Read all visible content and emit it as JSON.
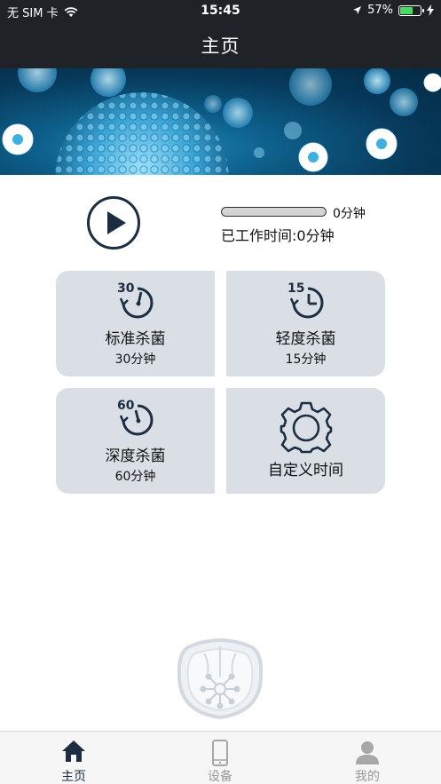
{
  "status_bar": {
    "carrier": "无 SIM 卡",
    "time": "15:45",
    "battery": "57%",
    "battery_level": 0.57,
    "icons": [
      "wifi-icon",
      "location-arrow-icon",
      "battery-icon",
      "charging-bolt-icon"
    ]
  },
  "header": {
    "title": "主页"
  },
  "timer": {
    "progress_fraction": 0,
    "progress_label": "0分钟",
    "worked_label": "已工作时间:0分钟",
    "play_icon": "play-icon"
  },
  "modes": [
    {
      "icon": "timer-30-icon",
      "icon_number": "30",
      "title": "标准杀菌",
      "duration": "30分钟"
    },
    {
      "icon": "timer-15-icon",
      "icon_number": "15",
      "title": "轻度杀菌",
      "duration": "15分钟"
    },
    {
      "icon": "timer-60-icon",
      "icon_number": "60",
      "title": "深度杀菌",
      "duration": "60分钟"
    },
    {
      "icon": "gear-icon",
      "title": "自定义时间"
    }
  ],
  "tabs": [
    {
      "icon": "home-icon",
      "label": "主页",
      "active": true
    },
    {
      "icon": "phone-device-icon",
      "label": "设备",
      "active": false
    },
    {
      "icon": "user-icon",
      "label": "我的",
      "active": false
    }
  ],
  "colors": {
    "header_bg": "#1f2227",
    "card_bg": "#d9dfe5",
    "icon_dark": "#1c2d42",
    "battery_green": "#4cd964"
  }
}
